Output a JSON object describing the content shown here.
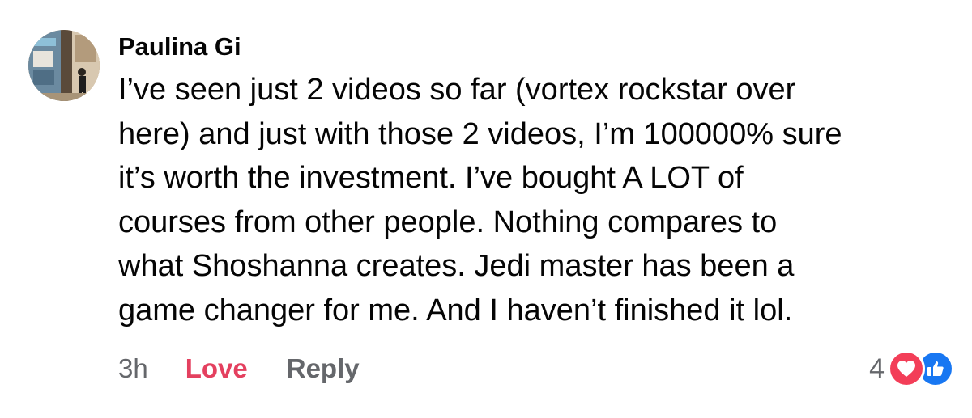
{
  "comment": {
    "author": "Paulina Gi",
    "lines": [
      "I’ve seen just 2 videos so far (vortex rockstar over",
      "here) and just with those 2 videos, I’m 100000% sure",
      "it’s worth the investment. I’ve bought A LOT of",
      "courses from other people. Nothing compares to",
      "what Shoshanna creates. Jedi master has been a",
      "game changer for me. And I haven’t finished it lol."
    ],
    "timestamp": "3h",
    "reaction_label": "Love",
    "reply_label": "Reply",
    "reaction_count": "4",
    "reaction_icons": [
      "heart-icon",
      "like-icon"
    ],
    "colors": {
      "love": "#e4405f",
      "heart_badge": "#f33e58",
      "like_badge": "#1877f2",
      "meta": "#65676b"
    }
  }
}
